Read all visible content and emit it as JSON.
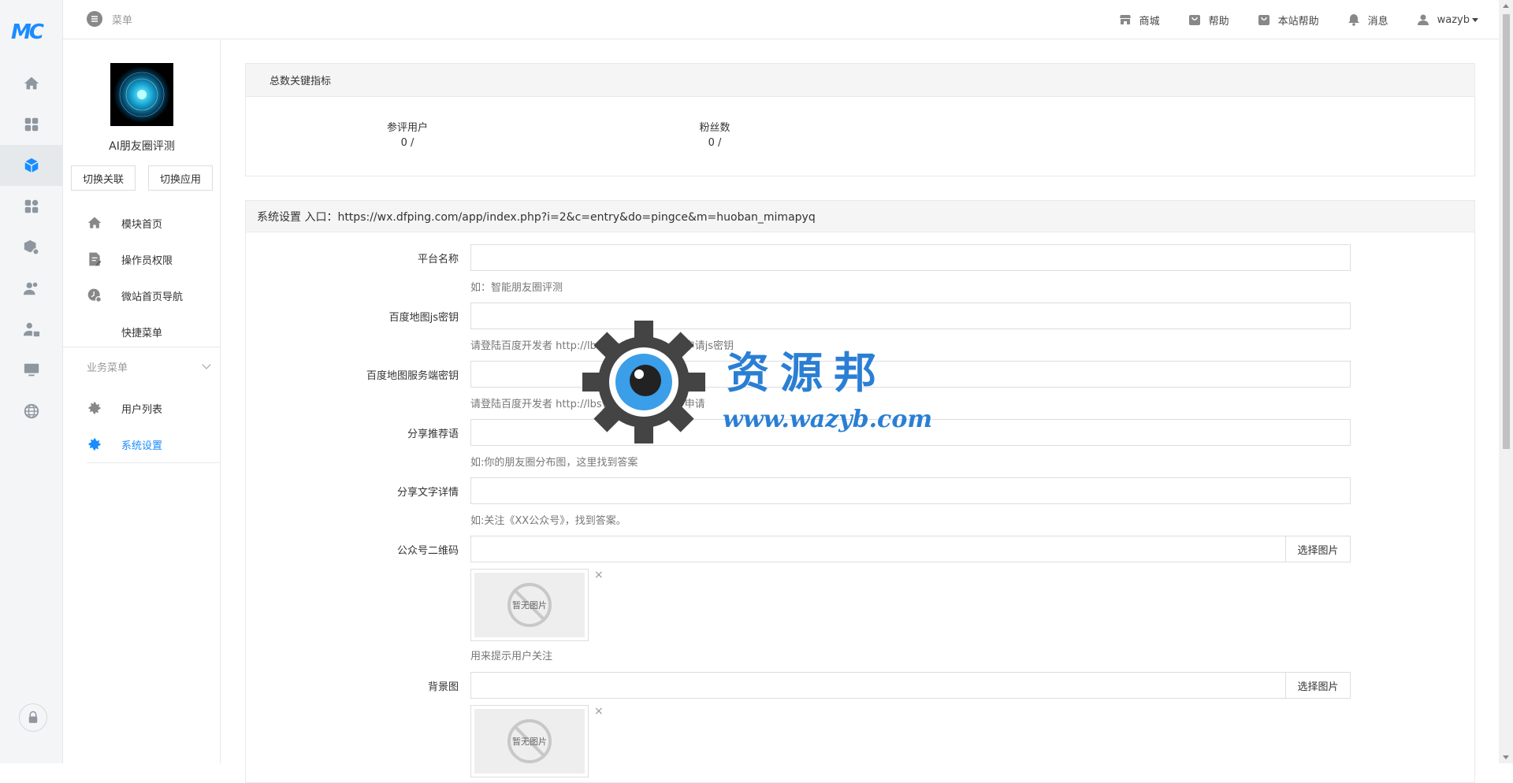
{
  "rail": {
    "logo": "MC",
    "icons": [
      "home-icon",
      "apps-grid-icon",
      "module-cube-icon",
      "plugin-grid-icon",
      "package-settings-icon",
      "users-icon",
      "user-lock-icon",
      "monitor-icon",
      "globe-icon",
      "lock-icon"
    ]
  },
  "topbar": {
    "menu_label": "菜单",
    "links": [
      {
        "label": "商城",
        "icon": "store-icon"
      },
      {
        "label": "帮助",
        "icon": "bag-icon"
      },
      {
        "label": "本站帮助",
        "icon": "bag-icon"
      },
      {
        "label": "消息",
        "icon": "bell-icon"
      }
    ],
    "user": "wazyb"
  },
  "module": {
    "name": "AI朋友圈评测",
    "switch_link": "切换关联",
    "switch_app": "切换应用",
    "menu": [
      {
        "label": "模块首页",
        "icon": "home-icon"
      },
      {
        "label": "操作员权限",
        "icon": "edit-doc-icon"
      },
      {
        "label": "微站首页导航",
        "icon": "nav-clock-icon"
      },
      {
        "label": "快捷菜单",
        "icon": ""
      }
    ],
    "section_label": "业务菜单",
    "business_menu": [
      {
        "label": "用户列表",
        "icon": "gear-icon"
      },
      {
        "label": "系统设置",
        "icon": "gear-icon"
      }
    ]
  },
  "stats_panel": {
    "title": "总数关键指标",
    "stats": [
      {
        "label": "参评用户",
        "value": "0 /"
      },
      {
        "label": "粉丝数",
        "value": "0 /"
      }
    ]
  },
  "settings_panel": {
    "title": "系统设置 入口：https://wx.dfping.com/app/index.php?i=2&c=entry&do=pingce&m=huoban_mimapyq",
    "fields": [
      {
        "label": "平台名称",
        "value": "",
        "help": "如：智能朋友圈评测"
      },
      {
        "label": "百度地图js密钥",
        "value": "",
        "help": "请登陆百度开发者 http://lbsyun.baidu.com/ 申请js密钥"
      },
      {
        "label": "百度地图服务端密钥",
        "value": "",
        "help": "请登陆百度开发者 http://lbsyun.baidu.com/ 申请"
      },
      {
        "label": "分享推荐语",
        "value": "",
        "help": "如:你的朋友圈分布图，这里找到答案"
      },
      {
        "label": "分享文字详情",
        "value": "",
        "help": "如:关注《XX公众号》，找到答案。"
      }
    ],
    "image_fields": [
      {
        "label": "公众号二维码",
        "button": "选择图片",
        "placeholder_img": "暂无图片",
        "help": "用来提示用户关注"
      },
      {
        "label": "背景图",
        "button": "选择图片",
        "placeholder_img": "暂无图片",
        "help": ""
      }
    ],
    "remove_mark": "×"
  },
  "watermark": {
    "title": "资源邦",
    "url": "www.wazyb.com"
  },
  "colors": {
    "accent": "#1a8cff",
    "rail_bg": "#f3f5f7",
    "panel_head": "#f5f5f5"
  }
}
